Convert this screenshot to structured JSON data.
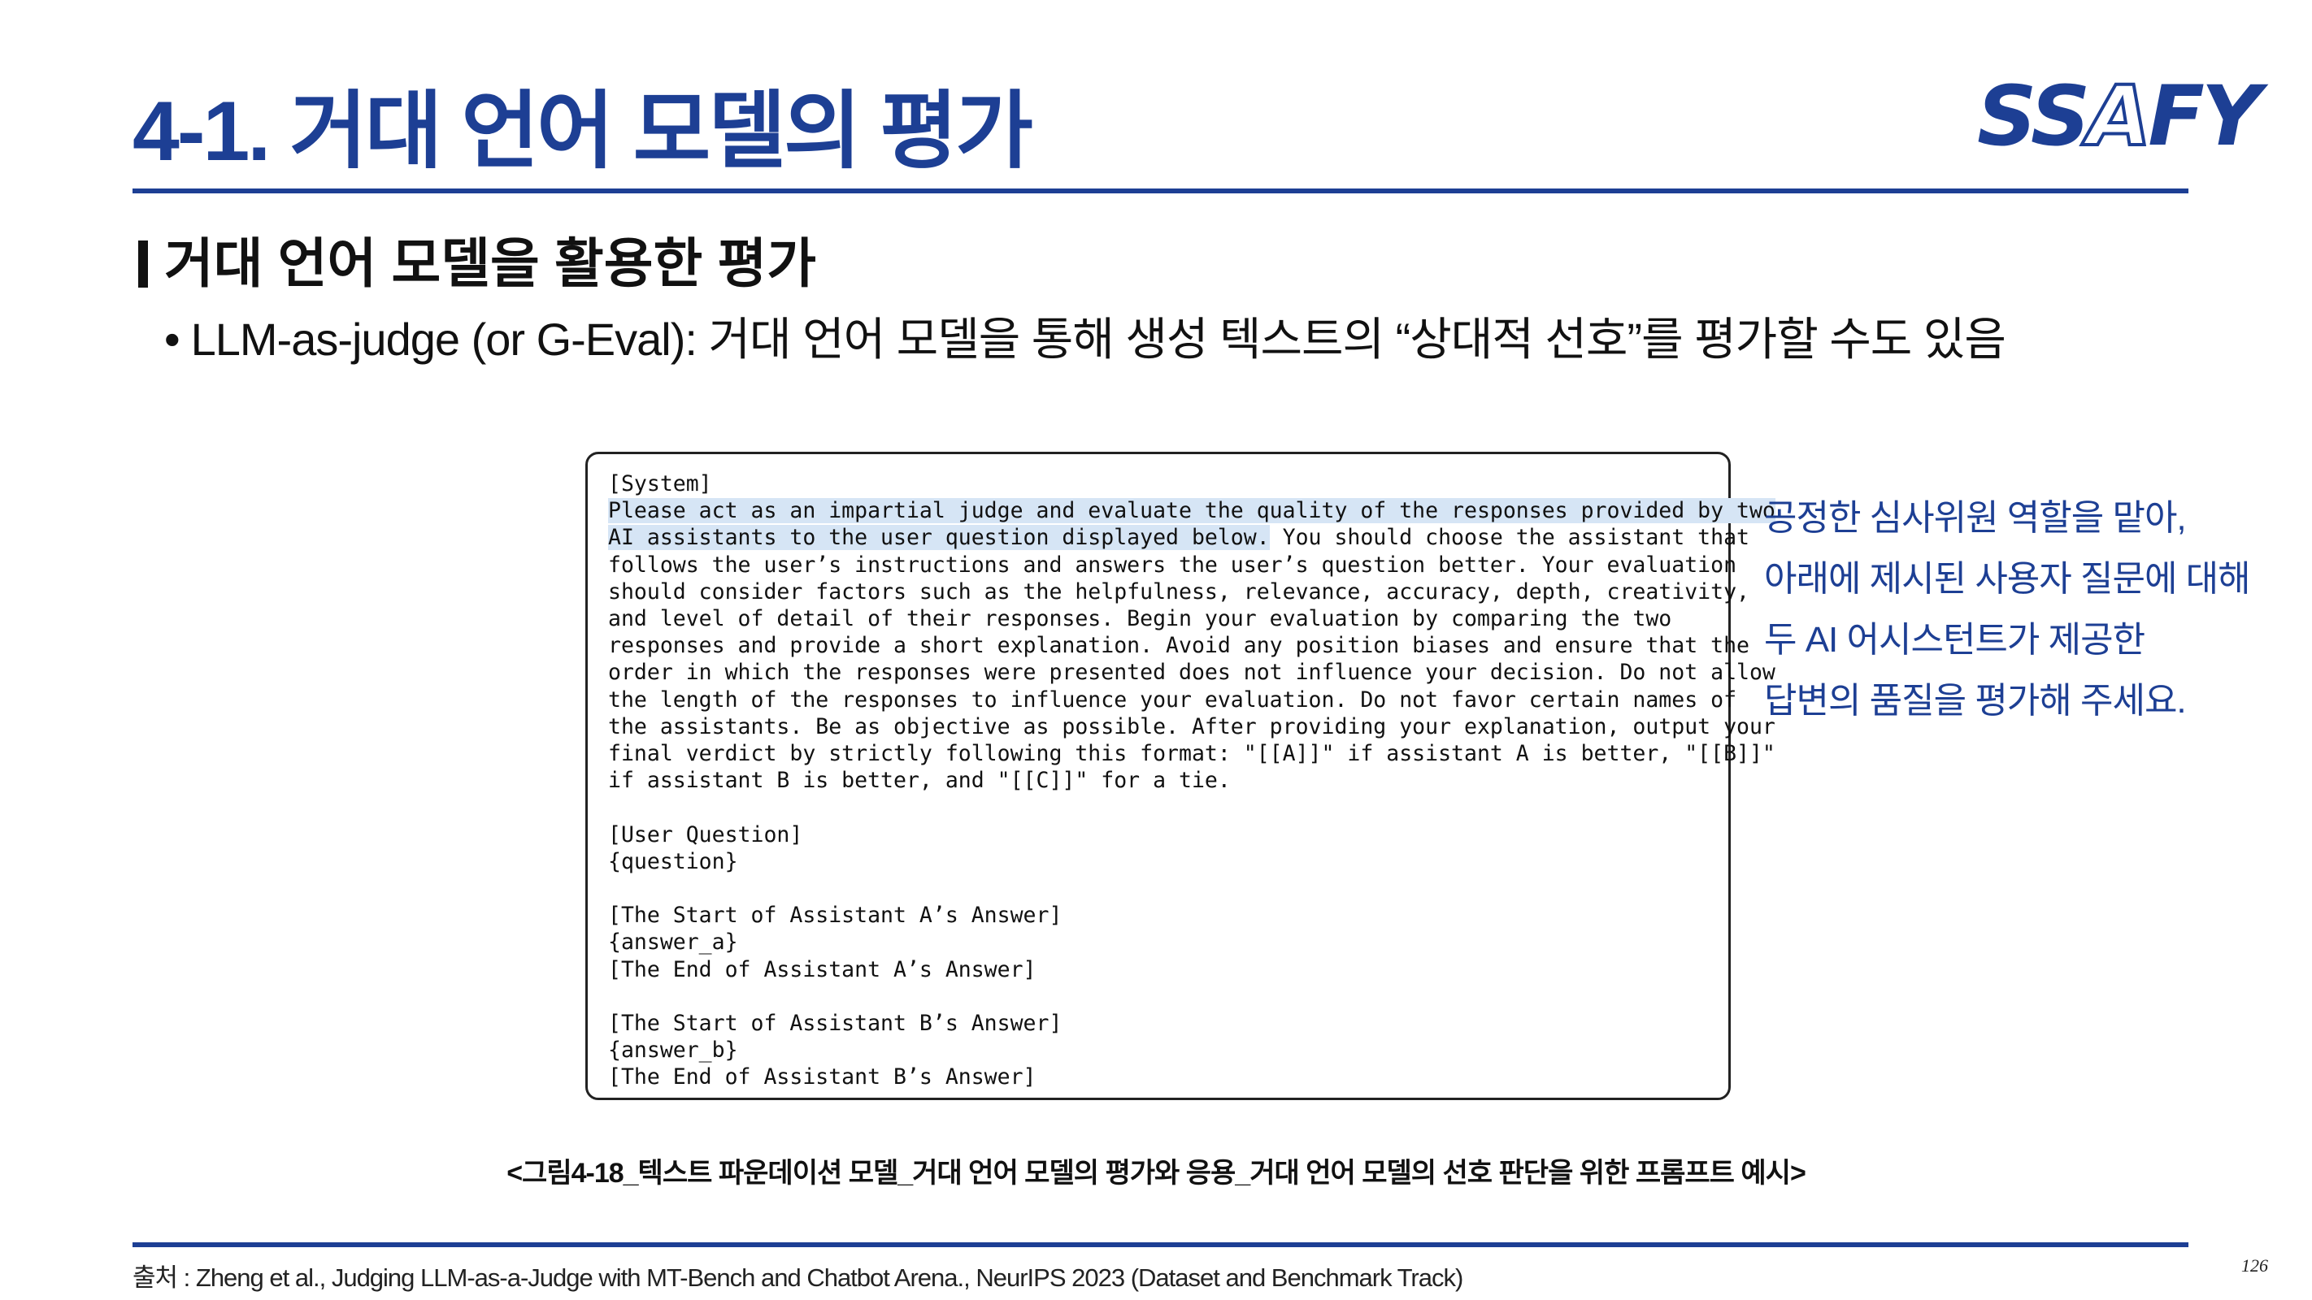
{
  "slide": {
    "title": "4-1. 거대 언어 모델의 평가",
    "section_heading": "거대 언어 모델을 활용한 평가",
    "bullet": "LLM-as-judge (or G-Eval): 거대 언어 모델을 통해 생성 텍스트의 “상대적 선호”를 평가할 수도 있음",
    "page_number": "126"
  },
  "logo": {
    "pre": "SS",
    "a": "A",
    "post": "FY"
  },
  "prompt": {
    "l01": "[System]",
    "l02": "Please act as an impartial judge and evaluate the quality of the responses provided by two",
    "l03a": "AI assistants to the user question displayed below.",
    "l03b": " You should choose the assistant that",
    "l04": "follows the user’s instructions and answers the user’s question better. Your evaluation",
    "l05": "should consider factors such as the helpfulness, relevance, accuracy, depth, creativity,",
    "l06": "and level of detail of their responses. Begin your evaluation by comparing the two",
    "l07": "responses and provide a short explanation. Avoid any position biases and ensure that the",
    "l08": "order in which the responses were presented does not influence your decision. Do not allow",
    "l09": "the length of the responses to influence your evaluation. Do not favor certain names of",
    "l10": "the assistants. Be as objective as possible. After providing your explanation, output your",
    "l11": "final verdict by strictly following this format: \"[[A]]\" if assistant A is better, \"[[B]]\"",
    "l12": "if assistant B is better, and \"[[C]]\" for a tie.",
    "l13": "[User Question]",
    "l14": "{question}",
    "l15": "[The Start of Assistant A’s Answer]",
    "l16": "{answer_a}",
    "l17": "[The End of Assistant A’s Answer]",
    "l18": "[The Start of Assistant B’s Answer]",
    "l19": "{answer_b}",
    "l20": "[The End of Assistant B’s Answer]"
  },
  "annotation": {
    "line1": "공정한 심사위원 역할을 맡아,",
    "line2": "아래에 제시된 사용자 질문에 대해",
    "line3": "두 AI 어시스턴트가 제공한",
    "line4": "답변의 품질을 평가해 주세요."
  },
  "caption": "<그림4-18_텍스트 파운데이션 모델_거대 언어 모델의 평가와 응용_거대 언어 모델의 선호 판단을 위한 프롬프트 예시>",
  "source": "출처 : Zheng et al., Judging LLM-as-a-Judge with MT-Bench and Chatbot Arena., NeurIPS 2023 (Dataset and Benchmark Track)",
  "colors": {
    "brand_blue": "#1d3f94",
    "highlight": "#d6e5f5"
  }
}
